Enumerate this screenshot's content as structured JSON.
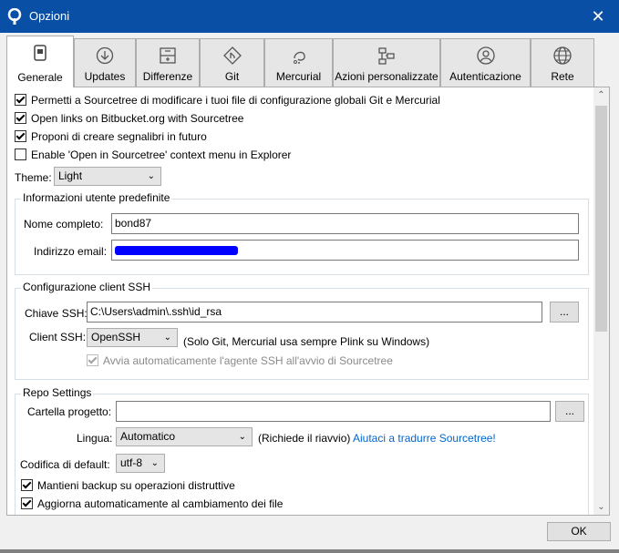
{
  "window": {
    "title": "Opzioni",
    "close_glyph": "✕",
    "accent": "#0a4fa6"
  },
  "tabs": [
    {
      "label": "Generale",
      "icon": "general-icon"
    },
    {
      "label": "Updates",
      "icon": "download-icon"
    },
    {
      "label": "Differenze",
      "icon": "diff-icon"
    },
    {
      "label": "Git",
      "icon": "git-icon"
    },
    {
      "label": "Mercurial",
      "icon": "mercurial-icon"
    },
    {
      "label": "Azioni personalizzate",
      "icon": "custom-actions-icon"
    },
    {
      "label": "Autenticazione",
      "icon": "user-icon"
    },
    {
      "label": "Rete",
      "icon": "globe-icon"
    }
  ],
  "general": {
    "options": [
      {
        "label": "Permetti a Sourcetree di modificare i tuoi file di configurazione globali Git e Mercurial",
        "checked": true
      },
      {
        "label": "Open links on Bitbucket.org with Sourcetree",
        "checked": true
      },
      {
        "label": "Proponi di creare segnalibri in futuro",
        "checked": true
      },
      {
        "label": "Enable 'Open in Sourcetree' context menu in Explorer",
        "checked": false
      }
    ],
    "theme_label": "Theme:",
    "theme_value": "Light"
  },
  "user_info": {
    "legend": "Informazioni utente predefinite",
    "name_label": "Nome completo:",
    "name_value": "bond87",
    "email_label": "Indirizzo email:"
  },
  "ssh": {
    "legend": "Configurazione client SSH",
    "key_label": "Chiave SSH:",
    "key_value": "C:\\Users\\admin\\.ssh\\id_rsa",
    "browse_label": "...",
    "client_label": "Client SSH:",
    "client_value": "OpenSSH",
    "client_note": "(Solo Git, Mercurial usa sempre Plink su Windows)",
    "agent_label": "Avvia automaticamente l'agente SSH all'avvio di Sourcetree",
    "agent_checked": true
  },
  "repo": {
    "legend": "Repo Settings",
    "folder_label": "Cartella progetto:",
    "folder_value": "",
    "browse_label": "...",
    "language_label": "Lingua:",
    "language_value": "Automatico",
    "language_note": "(Richiede il riavvio)",
    "translate_link": "Aiutaci a tradurre Sourcetree!",
    "encoding_label": "Codifica di default:",
    "encoding_value": "utf-8",
    "backup_label": "Mantieni backup su operazioni distruttive",
    "backup_checked": true,
    "autorefresh_label": "Aggiorna automaticamente al cambiamento dei file",
    "autorefresh_checked": true
  },
  "footer": {
    "ok_label": "OK"
  }
}
